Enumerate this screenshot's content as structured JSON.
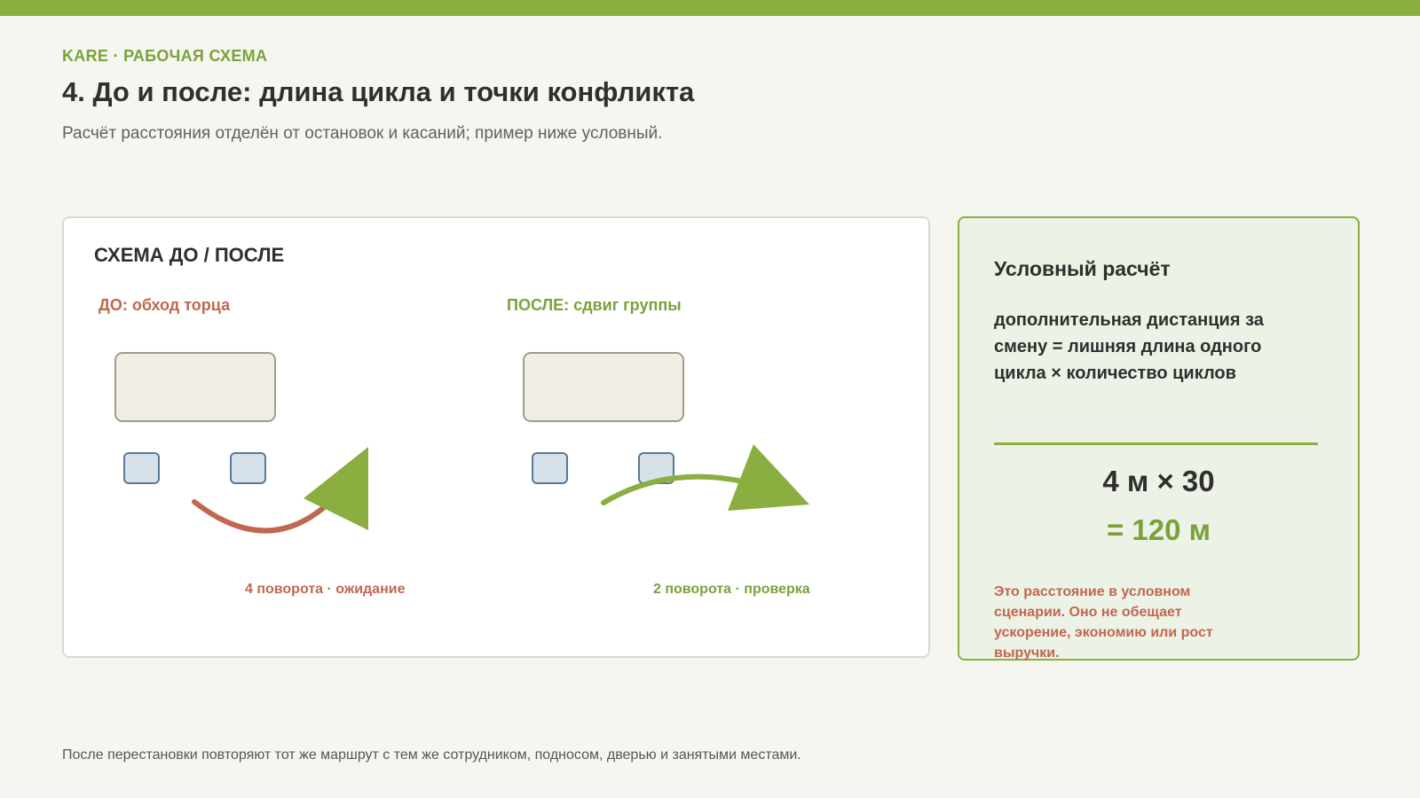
{
  "header": {
    "eyebrow": "KARE · РАБОЧАЯ СХЕМА",
    "title": "4. До и после: длина цикла и точки конфликта",
    "subtitle": "Расчёт расстояния отделён от остановок и касаний; пример ниже условный."
  },
  "scheme": {
    "heading": "СХЕМА ДО / ПОСЛЕ",
    "before": {
      "label": "ДО: обход торца",
      "caption": "4 поворота · ожидание",
      "color": "#c0674f"
    },
    "after": {
      "label": "ПОСЛЕ: сдвиг группы",
      "caption": "2 поворота · проверка",
      "color": "#7aa23a"
    },
    "colors": {
      "table_fill": "#f0ede5",
      "table_stroke": "#a09d8f",
      "chair_fill": "#d7e1ea",
      "chair_stroke": "#587a96",
      "arrow_green": "#8aae40"
    }
  },
  "calculation": {
    "heading": "Условный расчёт",
    "formula": "дополнительная дистанция за смену = лишняя длина одного цикла × количество циклов",
    "expression": "4 м × 30",
    "result": "= 120 м",
    "note": "Это расстояние в условном сценарии. Оно не обещает ускорение, экономию или рост выручки."
  },
  "footer": {
    "note": "После перестановки повторяют тот же маршрут с тем же сотрудником, подносом, дверью и занятыми местами."
  }
}
